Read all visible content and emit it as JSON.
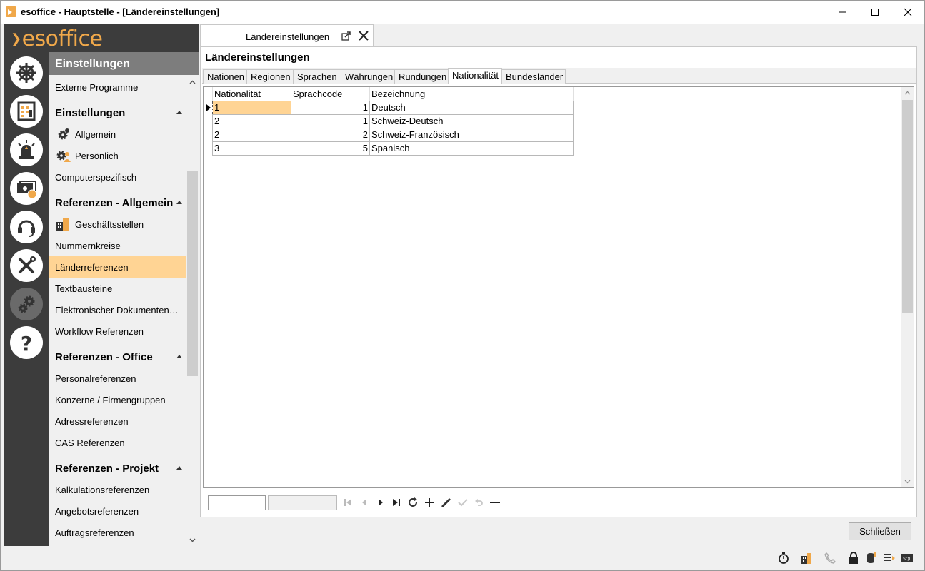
{
  "window": {
    "title": "esoffice - Hauptstelle - [Ländereinstellungen]"
  },
  "logo": {
    "text": "esoffice"
  },
  "rail": {
    "icons": [
      "ship-wheel-icon",
      "calendar-grid-icon",
      "alarm-light-icon",
      "money-icon",
      "headset-icon",
      "tools-icon",
      "gears-icon",
      "help-icon"
    ],
    "active": "gears-icon"
  },
  "nav": {
    "header": "Einstellungen",
    "items": [
      {
        "type": "item",
        "label": "Externe Programme"
      },
      {
        "type": "section",
        "label": "Einstellungen"
      },
      {
        "type": "icon-item",
        "label": "Allgemein",
        "icon": "gear-icon"
      },
      {
        "type": "icon-item",
        "label": "Persönlich",
        "icon": "gear-user-icon"
      },
      {
        "type": "item",
        "label": "Computerspezifisch"
      },
      {
        "type": "section",
        "label": "Referenzen - Allgemein"
      },
      {
        "type": "icon-item",
        "label": "Geschäftsstellen",
        "icon": "building-icon"
      },
      {
        "type": "item",
        "label": "Nummernkreise"
      },
      {
        "type": "item",
        "label": "Länderreferenzen",
        "selected": true
      },
      {
        "type": "item",
        "label": "Textbausteine"
      },
      {
        "type": "item",
        "label": "Elektronischer Dokumentenv..."
      },
      {
        "type": "item",
        "label": "Workflow Referenzen"
      },
      {
        "type": "section",
        "label": "Referenzen - Office"
      },
      {
        "type": "item",
        "label": "Personalreferenzen"
      },
      {
        "type": "item",
        "label": "Konzerne / Firmengruppen"
      },
      {
        "type": "item",
        "label": "Adressreferenzen"
      },
      {
        "type": "item",
        "label": "CAS Referenzen"
      },
      {
        "type": "section",
        "label": "Referenzen - Projekt"
      },
      {
        "type": "item",
        "label": "Kalkulationsreferenzen"
      },
      {
        "type": "item",
        "label": "Angebotsreferenzen"
      },
      {
        "type": "item",
        "label": "Auftragsreferenzen"
      }
    ]
  },
  "doc_tab": {
    "label": "Ländereinstellungen"
  },
  "page": {
    "title": "Ländereinstellungen",
    "tabs": [
      "Nationen",
      "Regionen",
      "Sprachen",
      "Währungen",
      "Rundungen",
      "Nationalität",
      "Bundesländer"
    ],
    "active_tab": "Nationalität"
  },
  "grid": {
    "columns": [
      "Nationalität",
      "Sprachcode",
      "Bezeichnung"
    ],
    "rows": [
      [
        "1",
        "1",
        "Deutsch"
      ],
      [
        "2",
        "1",
        "Schweiz-Deutsch"
      ],
      [
        "2",
        "2",
        "Schweiz-Französisch"
      ],
      [
        "3",
        "5",
        "Spanisch"
      ]
    ]
  },
  "footer": {
    "close_label": "Schließen"
  },
  "statusbar": {
    "icons": [
      "stopwatch-icon",
      "building-icon",
      "phone-icon",
      "lock-icon",
      "database-icon",
      "list-icon",
      "sql-icon"
    ]
  },
  "colors": {
    "accent": "#f0a84a",
    "selection": "#ffd494",
    "rail_bg": "#3c3c3c"
  }
}
